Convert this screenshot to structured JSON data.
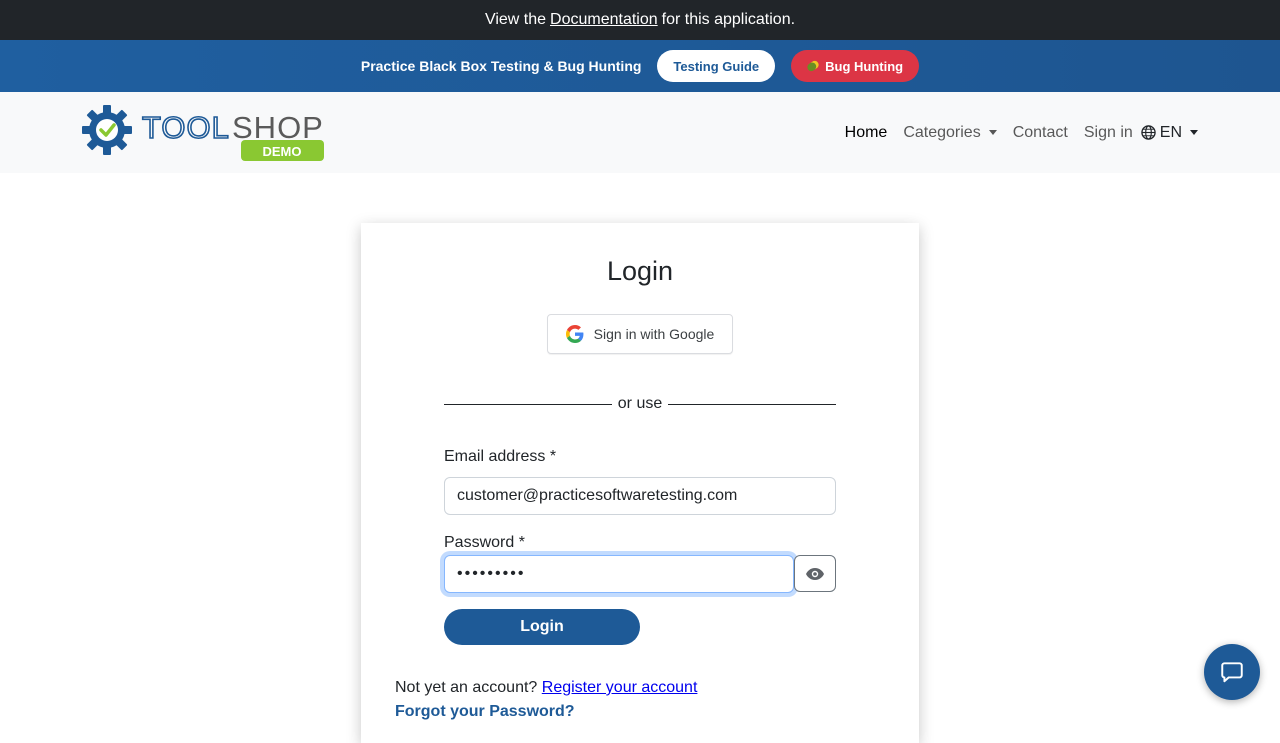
{
  "top_banner": {
    "prefix": "View the",
    "link": "Documentation",
    "suffix": "for this application."
  },
  "practice_bar": {
    "text": "Practice Black Box Testing & Bug Hunting",
    "testing_guide": "Testing Guide",
    "bug_hunting": "Bug Hunting"
  },
  "brand": {
    "name_part1": "TOOL",
    "name_part2": "SHOP",
    "badge": "DEMO"
  },
  "nav": {
    "home": "Home",
    "categories": "Categories",
    "contact": "Contact",
    "sign_in": "Sign in",
    "language": "EN"
  },
  "login": {
    "title": "Login",
    "google_label": "Sign in with Google",
    "divider": "or use",
    "email_label": "Email address *",
    "email_value": "customer@practicesoftwaretesting.com",
    "password_label": "Password *",
    "password_value": "•••••••••",
    "submit": "Login",
    "no_account": "Not yet an account?",
    "register_link": "Register your account",
    "forgot_link": "Forgot your Password?"
  },
  "colors": {
    "primary": "#1e5a97",
    "danger": "#dc3545",
    "dark": "#212529",
    "brand_green": "#8ac832"
  },
  "icons": [
    "google-icon",
    "eye-icon",
    "globe-icon",
    "chat-icon",
    "gear-logo-icon",
    "bug-icon"
  ]
}
